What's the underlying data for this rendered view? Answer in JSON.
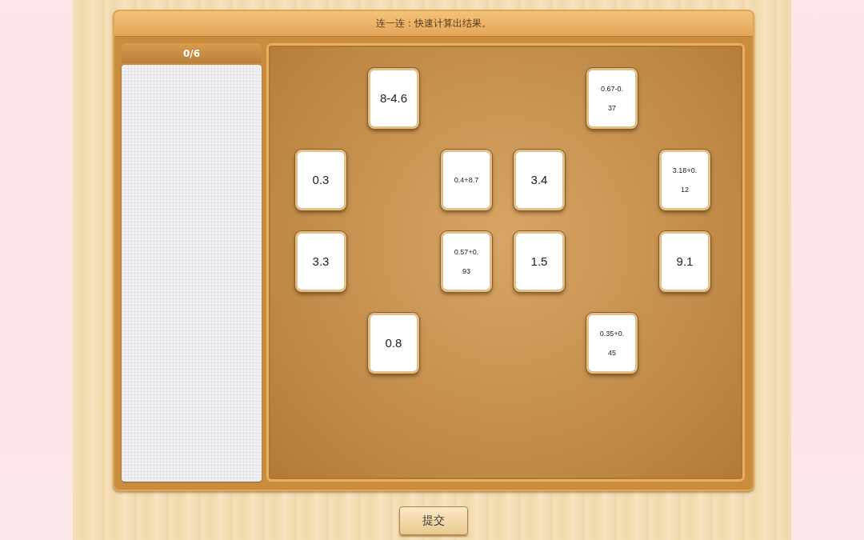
{
  "title": "连一连：快速计算出结果。",
  "score": "0/6",
  "cards": [
    {
      "text": "8-4.6",
      "kind": "plain"
    },
    {
      "text": "0.67-0.37",
      "kind": "compact"
    },
    {
      "text": "0.3",
      "kind": "plain"
    },
    {
      "text": "0.4+8.7",
      "kind": "compact"
    },
    {
      "text": "3.4",
      "kind": "plain"
    },
    {
      "text": "3.18+0.12",
      "kind": "compact"
    },
    {
      "text": "3.3",
      "kind": "plain"
    },
    {
      "text": "0.57+0.93",
      "kind": "compact"
    },
    {
      "text": "1.5",
      "kind": "plain"
    },
    {
      "text": "9.1",
      "kind": "plain"
    },
    {
      "text": "0.8",
      "kind": "plain"
    },
    {
      "text": "0.35+0.45",
      "kind": "compact"
    }
  ],
  "submit": "提交"
}
